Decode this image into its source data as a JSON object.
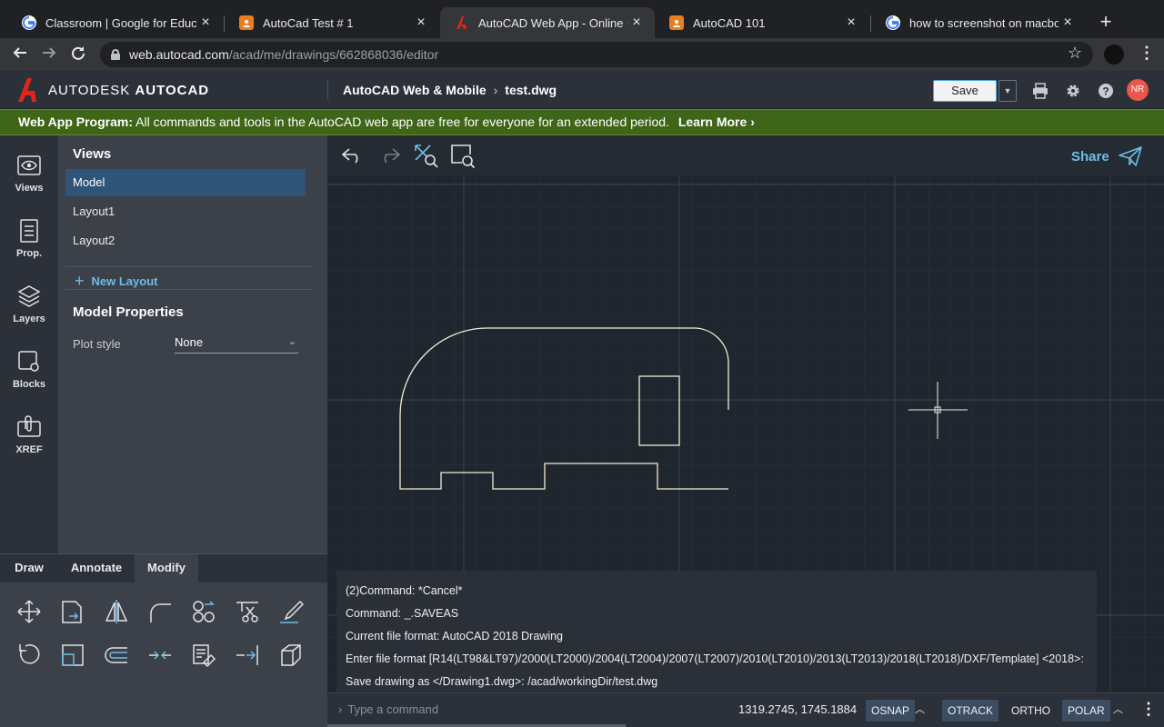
{
  "browser": {
    "tabs": [
      {
        "title": "Classroom | Google for Educat",
        "favicon": "google-icon",
        "active": false
      },
      {
        "title": "AutoCad Test # 1",
        "favicon": "classroom-icon",
        "active": false
      },
      {
        "title": "AutoCAD Web App - Online CA",
        "favicon": "autocad-icon",
        "active": true
      },
      {
        "title": "AutoCAD 101",
        "favicon": "classroom-icon",
        "active": false
      },
      {
        "title": "how to screenshot on macboo",
        "favicon": "google-icon",
        "active": false
      }
    ],
    "new_tab": "+",
    "url_host": "web.autocad.com",
    "url_path": "/acad/me/drawings/662868036/editor"
  },
  "app": {
    "brand_light": "AUTODESK",
    "brand_bold": "AUTOCAD",
    "breadcrumb_product": "AutoCAD Web & Mobile",
    "breadcrumb_file": "test.dwg",
    "save_label": "Save",
    "avatar_initials": "NR"
  },
  "banner": {
    "lead": "Web App Program:",
    "text": "All commands and tools in the AutoCAD web app are free for everyone for an extended period.",
    "link": "Learn More",
    "link_icon": "›"
  },
  "rail": [
    {
      "label": "Views",
      "icon": "eye-icon"
    },
    {
      "label": "Prop.",
      "icon": "properties-icon"
    },
    {
      "label": "Layers",
      "icon": "layers-icon"
    },
    {
      "label": "Blocks",
      "icon": "blocks-icon"
    },
    {
      "label": "XREF",
      "icon": "xref-icon"
    }
  ],
  "views_panel": {
    "title": "Views",
    "items": [
      "Model",
      "Layout1",
      "Layout2"
    ],
    "selected": "Model",
    "new_layout": "New Layout",
    "properties_title": "Model Properties",
    "plot_style_label": "Plot style",
    "plot_style_value": "None"
  },
  "tool_tabs": [
    "Draw",
    "Annotate",
    "Modify"
  ],
  "active_tool_tab": "Modify",
  "tools": [
    "move-icon",
    "copy-icon",
    "mirror-icon",
    "fillet-icon",
    "array-icon",
    "trim-icon",
    "erase-icon",
    "rotate-icon",
    "scale-icon",
    "offset-icon",
    "join-icon",
    "match-properties-icon",
    "extend-icon",
    "explode-icon"
  ],
  "canvas_toolbar": {
    "share_label": "Share"
  },
  "command_history": [
    "(2)Command: *Cancel*",
    "Command: _.SAVEAS",
    "Current file format: AutoCAD 2018 Drawing",
    "Enter file format [R14(LT98&LT97)/2000(LT2000)/2004(LT2004)/2007(LT2007)/2010(LT2010)/2013(LT2013)/2018(LT2018)/DXF/Template] <2018>:",
    "Save drawing as </Drawing1.dwg>: /acad/workingDir/test.dwg"
  ],
  "status_bar": {
    "command_placeholder": "Type a command",
    "coordinates": "1319.2745, 1745.1884",
    "modes": [
      {
        "label": "OSNAP",
        "on": true
      },
      {
        "label": "OTRACK",
        "on": true
      },
      {
        "label": "ORTHO",
        "on": false
      },
      {
        "label": "POLAR",
        "on": true
      }
    ]
  },
  "colors": {
    "accent": "#6fbce8",
    "banner_green": "#3f6518",
    "autocad_red": "#e1251b",
    "drawing_line": "#f3ecd2",
    "selection": "#2f5478"
  }
}
